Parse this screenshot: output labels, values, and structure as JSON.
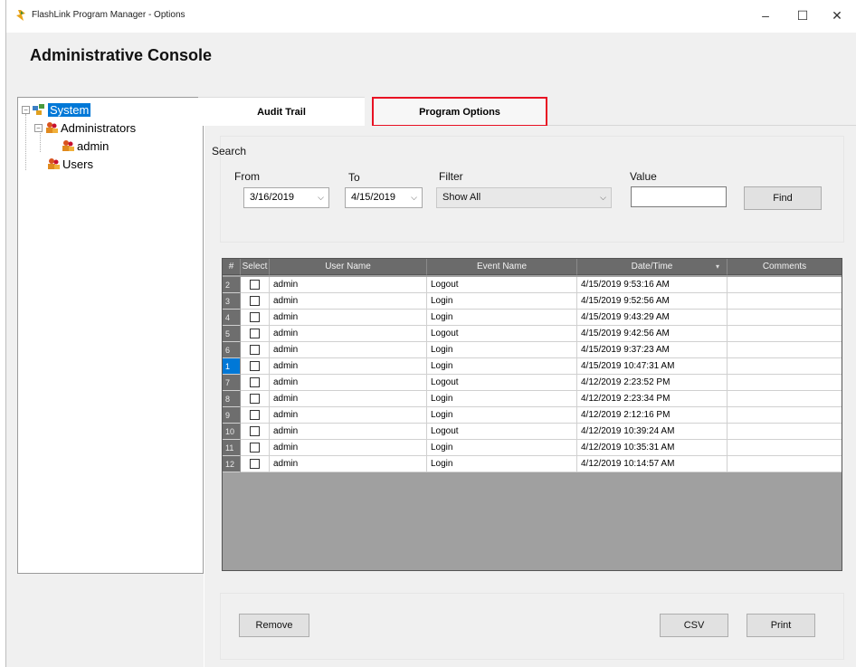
{
  "window": {
    "title": "FlashLink Program Manager - Options",
    "minimize": "–",
    "maximize": "☐",
    "close": "✕"
  },
  "console_title": "Administrative Console",
  "tree": {
    "root": "System",
    "administrators": "Administrators",
    "admin_user": "admin",
    "users": "Users"
  },
  "tabs": {
    "audit_trail": "Audit Trail",
    "program_options": "Program Options"
  },
  "search": {
    "group_label": "Search",
    "from_label": "From",
    "from_value": "3/16/2019",
    "to_label": "To",
    "to_value": "4/15/2019",
    "filter_label": "Filter",
    "filter_value": "Show All",
    "value_label": "Value",
    "value_text": "",
    "find_label": "Find"
  },
  "grid": {
    "columns": [
      "#",
      "Select",
      "User Name",
      "Event Name",
      "Date/Time",
      "Comments"
    ],
    "rows": [
      {
        "num": "2",
        "user": "admin",
        "event": "Logout",
        "datetime": "4/15/2019 9:53:16 AM",
        "comments": ""
      },
      {
        "num": "3",
        "user": "admin",
        "event": "Login",
        "datetime": "4/15/2019 9:52:56 AM",
        "comments": ""
      },
      {
        "num": "4",
        "user": "admin",
        "event": "Login",
        "datetime": "4/15/2019 9:43:29 AM",
        "comments": ""
      },
      {
        "num": "5",
        "user": "admin",
        "event": "Logout",
        "datetime": "4/15/2019 9:42:56 AM",
        "comments": ""
      },
      {
        "num": "6",
        "user": "admin",
        "event": "Login",
        "datetime": "4/15/2019 9:37:23 AM",
        "comments": ""
      },
      {
        "num": "1",
        "user": "admin",
        "event": "Login",
        "datetime": "4/15/2019 10:47:31 AM",
        "comments": ""
      },
      {
        "num": "7",
        "user": "admin",
        "event": "Logout",
        "datetime": "4/12/2019 2:23:52 PM",
        "comments": ""
      },
      {
        "num": "8",
        "user": "admin",
        "event": "Login",
        "datetime": "4/12/2019 2:23:34 PM",
        "comments": ""
      },
      {
        "num": "9",
        "user": "admin",
        "event": "Login",
        "datetime": "4/12/2019 2:12:16 PM",
        "comments": ""
      },
      {
        "num": "10",
        "user": "admin",
        "event": "Logout",
        "datetime": "4/12/2019 10:39:24 AM",
        "comments": ""
      },
      {
        "num": "11",
        "user": "admin",
        "event": "Login",
        "datetime": "4/12/2019 10:35:31 AM",
        "comments": ""
      },
      {
        "num": "12",
        "user": "admin",
        "event": "Login",
        "datetime": "4/12/2019 10:14:57 AM",
        "comments": ""
      }
    ]
  },
  "actions": {
    "remove": "Remove",
    "csv": "CSV",
    "print": "Print"
  },
  "colors": {
    "tree_selection": "#0078d7",
    "tab_highlight": "#e81123",
    "grid_header": "#6b6b6b",
    "current_row_header": "#0078d7"
  }
}
